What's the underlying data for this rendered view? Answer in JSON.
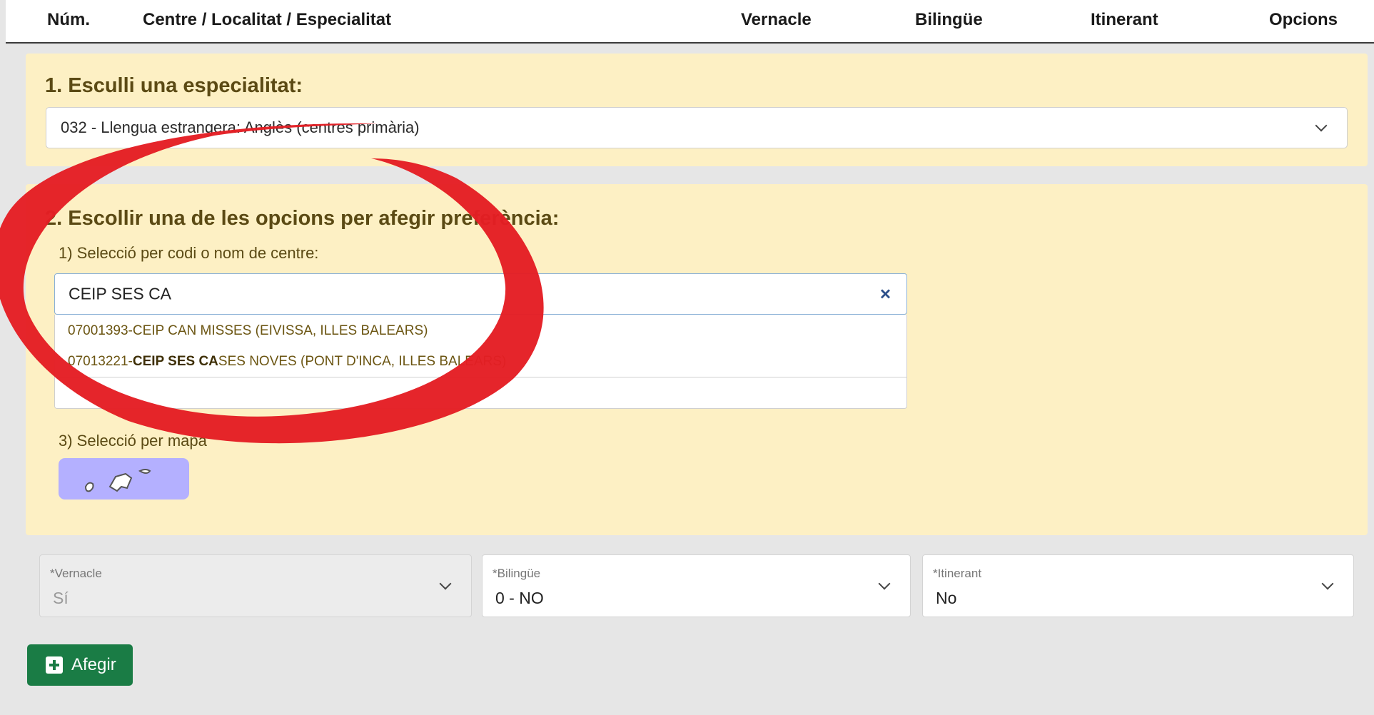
{
  "header": {
    "num": "Núm.",
    "centre": "Centre / Localitat / Especialitat",
    "vernacle": "Vernacle",
    "bilingue": "Bilingüe",
    "itinerant": "Itinerant",
    "opcions": "Opcions"
  },
  "step1": {
    "title": "1. Esculli una especialitat:",
    "selected": "032 - Llengua estrangera: Anglès (centres primària)"
  },
  "step2": {
    "title": "2. Escollir una de les opcions per afegir preferència:",
    "option1_label": "1) Selecció per codi o nom de centre:",
    "search_value": "CEIP SES CA",
    "clear_symbol": "×",
    "suggestions": [
      {
        "code": "07001393-",
        "match": "",
        "rest": "CEIP CAN MISSES (EIVISSA, ILLES BALEARS)"
      },
      {
        "code": "07013221-",
        "match": "CEIP SES CA",
        "rest": "SES NOVES (PONT D'INCA, ILLES BALEARS)"
      }
    ],
    "option3_label": "3) Selecció per mapa"
  },
  "fields": {
    "vernacle": {
      "label": "*Vernacle",
      "value": "Sí"
    },
    "bilingue": {
      "label": "*Bilingüe",
      "value": "0 - NO"
    },
    "itinerant": {
      "label": "*Itinerant",
      "value": "No"
    }
  },
  "add_button": {
    "label": "Afegir"
  },
  "colors": {
    "panel_bg": "#fdf0c4",
    "add_button": "#1a7c45",
    "annotation_ring": "#e41e24",
    "map_button": "#b4b0ff"
  },
  "icons": [
    "chevron-down-icon",
    "close-icon",
    "plus-square-icon",
    "balearic-islands-map-icon"
  ]
}
